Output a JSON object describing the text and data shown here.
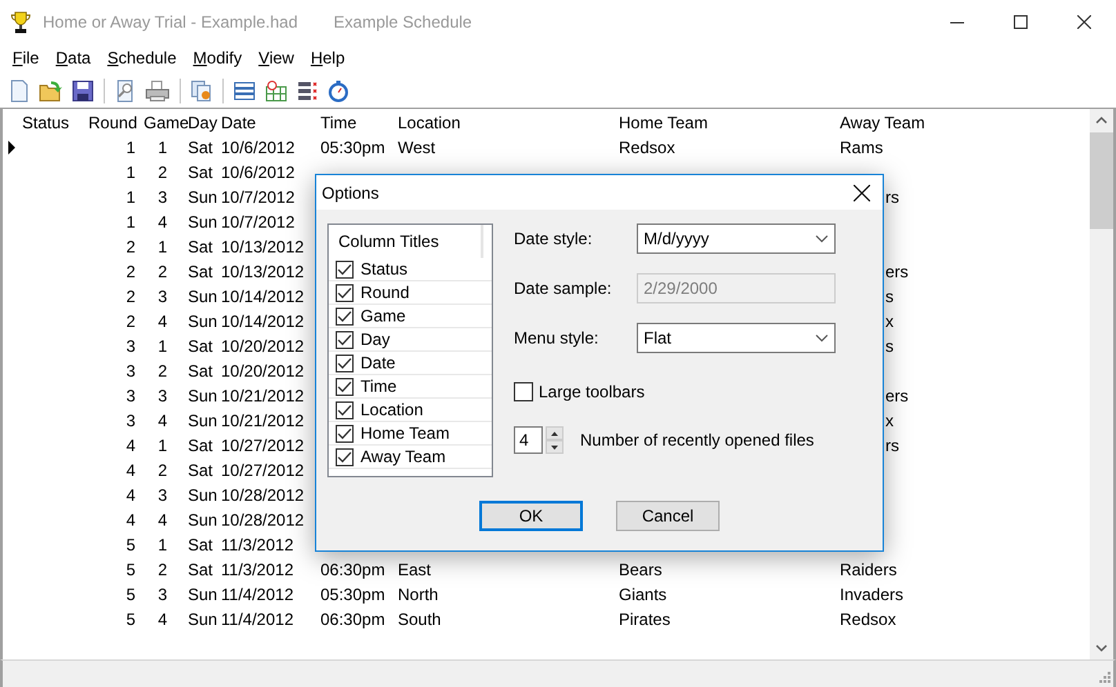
{
  "window": {
    "title": "Home or Away Trial - Example.had",
    "document_title": "Example Schedule"
  },
  "menu": [
    "File",
    "Data",
    "Schedule",
    "Modify",
    "View",
    "Help"
  ],
  "table": {
    "columns": [
      "Status",
      "Round",
      "Game",
      "Day",
      "Date",
      "Time",
      "Location",
      "Home Team",
      "Away Team"
    ],
    "rows": [
      {
        "current": true,
        "round": "1",
        "game": "1",
        "day": "Sat",
        "date": "10/6/2012",
        "time": "05:30pm",
        "location": "West",
        "home_team": "Redsox",
        "away_team": "Rams"
      },
      {
        "current": false,
        "round": "1",
        "game": "2",
        "day": "Sat",
        "date": "10/6/2012"
      },
      {
        "current": false,
        "round": "1",
        "game": "3",
        "day": "Sun",
        "date": "10/7/2012",
        "away_team_partial": "rs"
      },
      {
        "current": false,
        "round": "1",
        "game": "4",
        "day": "Sun",
        "date": "10/7/2012"
      },
      {
        "current": false,
        "round": "2",
        "game": "1",
        "day": "Sat",
        "date": "10/13/2012"
      },
      {
        "current": false,
        "round": "2",
        "game": "2",
        "day": "Sat",
        "date": "10/13/2012",
        "away_team_partial": "ers"
      },
      {
        "current": false,
        "round": "2",
        "game": "3",
        "day": "Sun",
        "date": "10/14/2012",
        "away_team_partial": "s"
      },
      {
        "current": false,
        "round": "2",
        "game": "4",
        "day": "Sun",
        "date": "10/14/2012",
        "away_team_partial": "x"
      },
      {
        "current": false,
        "round": "3",
        "game": "1",
        "day": "Sat",
        "date": "10/20/2012",
        "away_team_partial": "s"
      },
      {
        "current": false,
        "round": "3",
        "game": "2",
        "day": "Sat",
        "date": "10/20/2012"
      },
      {
        "current": false,
        "round": "3",
        "game": "3",
        "day": "Sun",
        "date": "10/21/2012",
        "away_team_partial": "ers"
      },
      {
        "current": false,
        "round": "3",
        "game": "4",
        "day": "Sun",
        "date": "10/21/2012",
        "away_team_partial": "x"
      },
      {
        "current": false,
        "round": "4",
        "game": "1",
        "day": "Sat",
        "date": "10/27/2012",
        "away_team_partial": "rs"
      },
      {
        "current": false,
        "round": "4",
        "game": "2",
        "day": "Sat",
        "date": "10/27/2012"
      },
      {
        "current": false,
        "round": "4",
        "game": "3",
        "day": "Sun",
        "date": "10/28/2012"
      },
      {
        "current": false,
        "round": "4",
        "game": "4",
        "day": "Sun",
        "date": "10/28/2012"
      },
      {
        "current": false,
        "round": "5",
        "game": "1",
        "day": "Sat",
        "date": "11/3/2012"
      },
      {
        "current": false,
        "round": "5",
        "game": "2",
        "day": "Sat",
        "date": "11/3/2012",
        "time": "06:30pm",
        "location": "East",
        "home_team": "Bears",
        "away_team": "Raiders"
      },
      {
        "current": false,
        "round": "5",
        "game": "3",
        "day": "Sun",
        "date": "11/4/2012",
        "time": "05:30pm",
        "location": "North",
        "home_team": "Giants",
        "away_team": "Invaders"
      },
      {
        "current": false,
        "round": "5",
        "game": "4",
        "day": "Sun",
        "date": "11/4/2012",
        "time": "06:30pm",
        "location": "South",
        "home_team": "Pirates",
        "away_team": "Redsox"
      }
    ]
  },
  "options_dialog": {
    "title": "Options",
    "column_titles": {
      "header": "Column Titles",
      "items": [
        {
          "label": "Status",
          "checked": true
        },
        {
          "label": "Round",
          "checked": true
        },
        {
          "label": "Game",
          "checked": true
        },
        {
          "label": "Day",
          "checked": true
        },
        {
          "label": "Date",
          "checked": true
        },
        {
          "label": "Time",
          "checked": true
        },
        {
          "label": "Location",
          "checked": true
        },
        {
          "label": "Home Team",
          "checked": true
        },
        {
          "label": "Away Team",
          "checked": true
        }
      ]
    },
    "date_style": {
      "label": "Date style:",
      "value": "M/d/yyyy",
      "disabled": false
    },
    "date_sample": {
      "label": "Date sample:",
      "value": "2/29/2000",
      "disabled": true
    },
    "menu_style": {
      "label": "Menu style:",
      "value": "Flat",
      "disabled": false
    },
    "large_toolbars": {
      "label": "Large toolbars",
      "checked": false
    },
    "recent_files": {
      "value": "4",
      "label": "Number of recently opened files"
    },
    "buttons": [
      {
        "label": "OK",
        "default": true
      },
      {
        "label": "Cancel",
        "default": false
      }
    ]
  }
}
